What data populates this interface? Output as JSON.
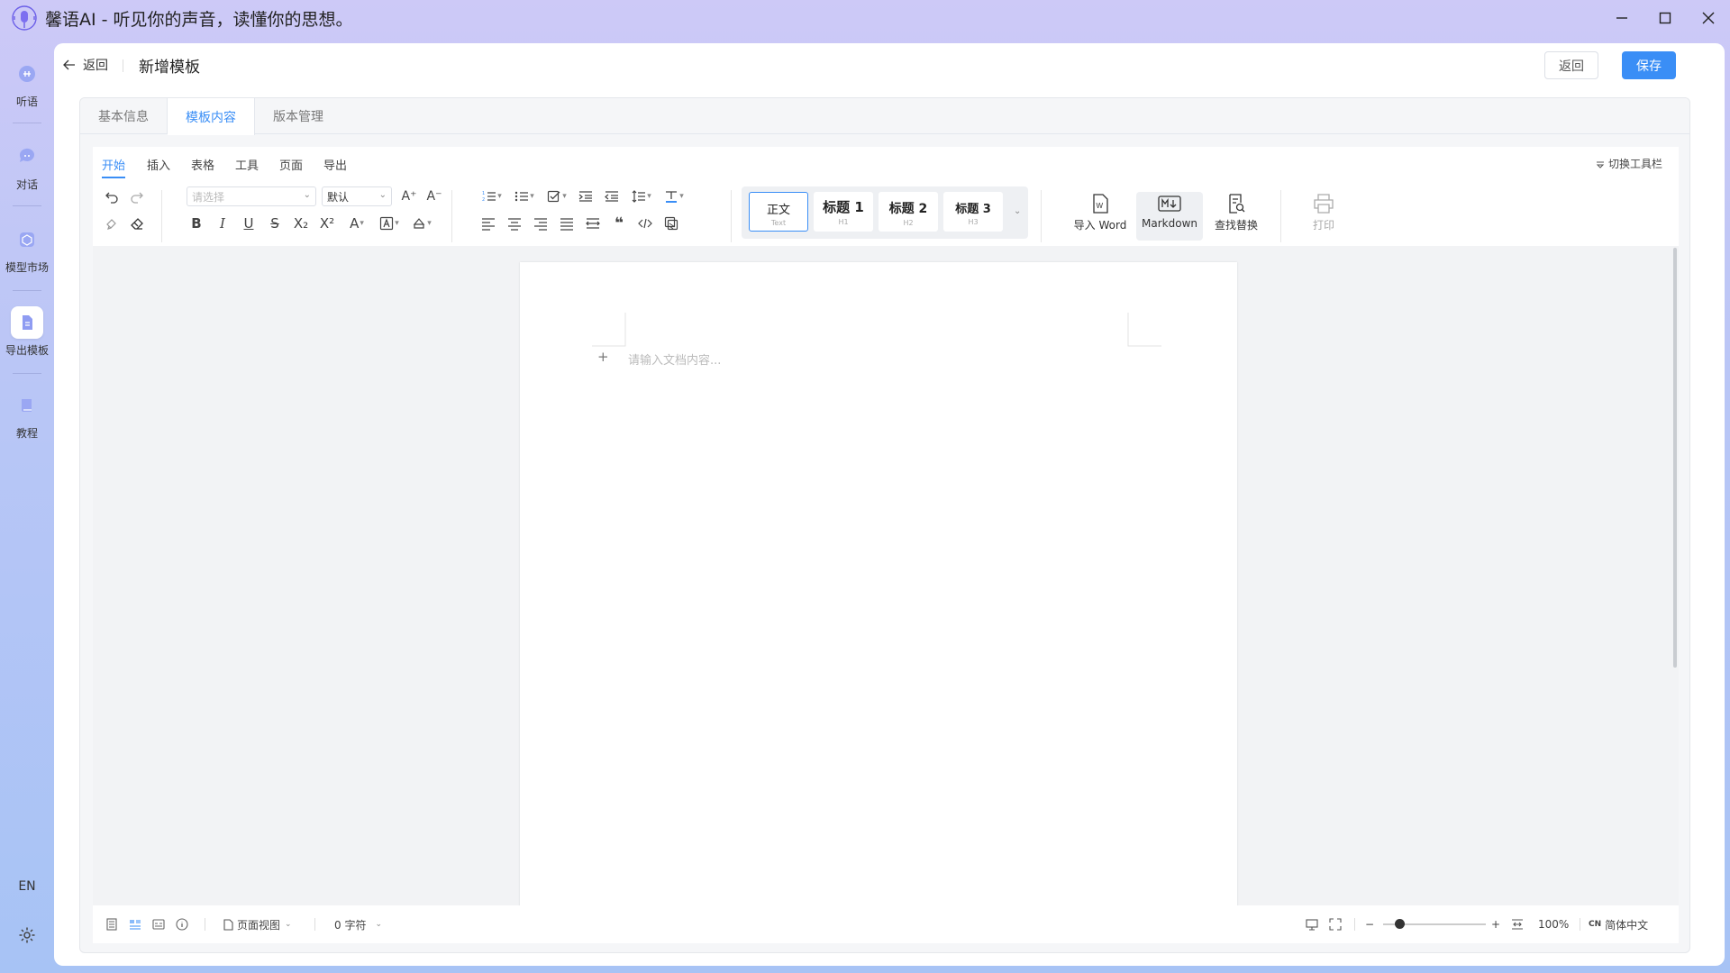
{
  "window": {
    "title": "馨语AI - 听见你的声音，读懂你的思想。"
  },
  "rail": {
    "items": [
      {
        "label": "听语"
      },
      {
        "label": "对话"
      },
      {
        "label": "模型市场"
      },
      {
        "label": "导出模板"
      },
      {
        "label": "教程"
      }
    ],
    "lang": "EN"
  },
  "header": {
    "back_label": "返回",
    "title": "新增模板",
    "cancel_label": "返回",
    "save_label": "保存"
  },
  "tabs": [
    {
      "label": "基本信息"
    },
    {
      "label": "模板内容"
    },
    {
      "label": "版本管理"
    }
  ],
  "toolbar": {
    "menus": [
      "开始",
      "插入",
      "表格",
      "工具",
      "页面",
      "导出"
    ],
    "toggle_label": "切换工具栏",
    "font_family_placeholder": "请选择",
    "font_size_value": "默认",
    "styles": [
      {
        "main": "正文",
        "sub": "Text"
      },
      {
        "main": "标题 1",
        "sub": "H1"
      },
      {
        "main": "标题 2",
        "sub": "H2"
      },
      {
        "main": "标题 3",
        "sub": "H3"
      }
    ],
    "import_word_label": "导入 Word",
    "markdown_label": "Markdown",
    "find_replace_label": "查找替换",
    "print_label": "打印"
  },
  "document": {
    "placeholder": "请输入文档内容..."
  },
  "statusbar": {
    "view_mode": "页面视图",
    "char_count": "0 字符",
    "zoom": "100%",
    "lang_code": "CN",
    "lang_label": "简体中文",
    "zoom_fraction": 0.16
  },
  "colors": {
    "accent": "#3a8ef6",
    "rail_icon": "#8f9cf2"
  }
}
